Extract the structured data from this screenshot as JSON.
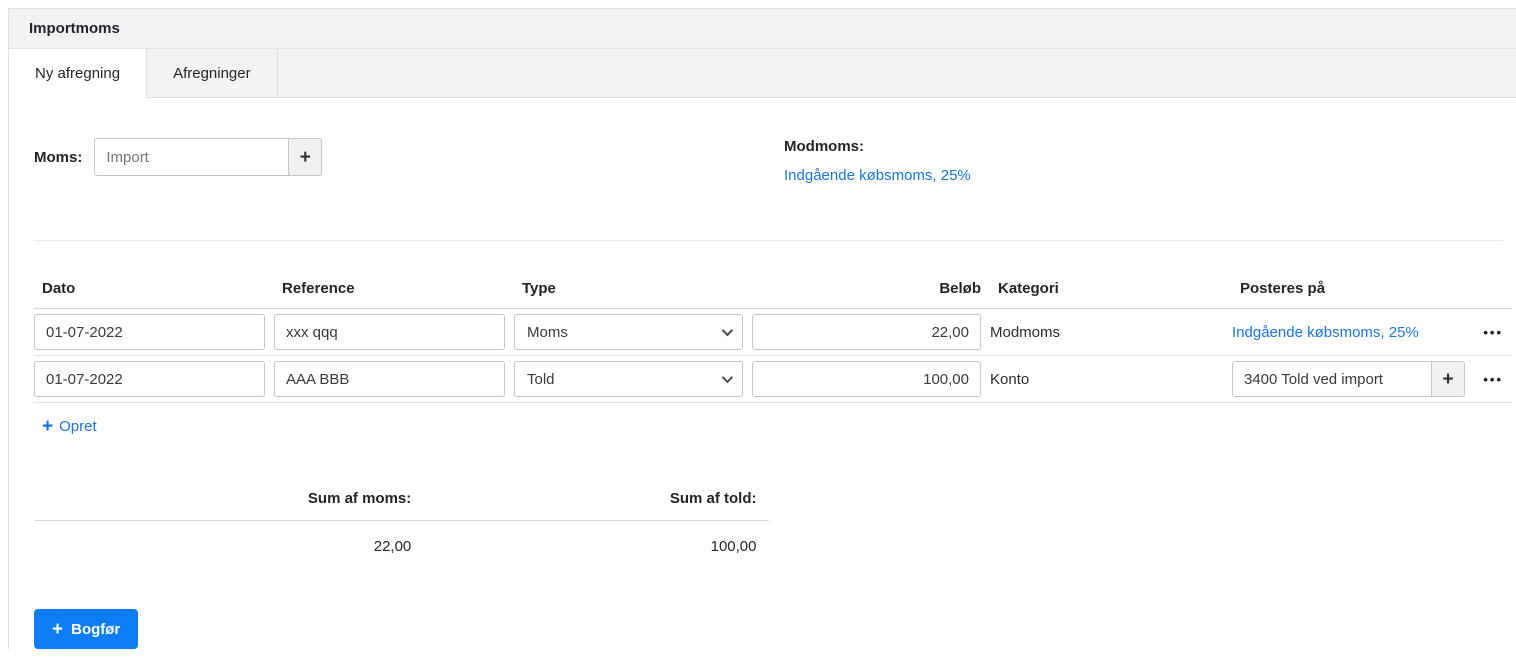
{
  "titlebar": {
    "title": "Importmoms"
  },
  "tabs": {
    "new_settlement": "Ny afregning",
    "settlements": "Afregninger"
  },
  "form": {
    "moms_label": "Moms:",
    "moms_placeholder": "Import",
    "modmoms_label": "Modmoms:",
    "modmoms_link": "Indgående købsmoms, 25%"
  },
  "table": {
    "headers": {
      "dato": "Dato",
      "reference": "Reference",
      "type": "Type",
      "belob": "Beløb",
      "kategori": "Kategori",
      "posteres": "Posteres på"
    },
    "rows": [
      {
        "dato": "01-07-2022",
        "reference": "xxx qqq",
        "type": "Moms",
        "belob": "22,00",
        "kategori": "Modmoms",
        "posteres_link": "Indgående købsmoms, 25%"
      },
      {
        "dato": "01-07-2022",
        "reference": "AAA BBB",
        "type": "Told",
        "belob": "100,00",
        "kategori": "Konto",
        "posteres_value": "3400 Told ved import"
      }
    ],
    "create_label": "Opret"
  },
  "summary": {
    "moms_header": "Sum af moms:",
    "told_header": "Sum af told:",
    "moms_value": "22,00",
    "told_value": "100,00"
  },
  "actions": {
    "bogfor_label": "Bogfør"
  },
  "icons": {
    "plus": "+",
    "ellipsis": "•••"
  },
  "colors": {
    "primary": "#0d7df5",
    "link": "#1b74e4"
  }
}
